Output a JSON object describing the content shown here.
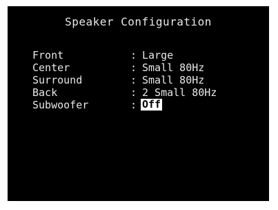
{
  "menu": {
    "title": "Speaker Configuration",
    "separator": ":",
    "rows": [
      {
        "label": "Front",
        "value": "Large"
      },
      {
        "label": "Center",
        "value": "Small 80Hz"
      },
      {
        "label": "Surround",
        "value": "Small 80Hz"
      },
      {
        "label": "Back",
        "value": "2 Small 80Hz"
      },
      {
        "label": "Subwoofer",
        "value": "Off",
        "selected": true
      }
    ]
  }
}
